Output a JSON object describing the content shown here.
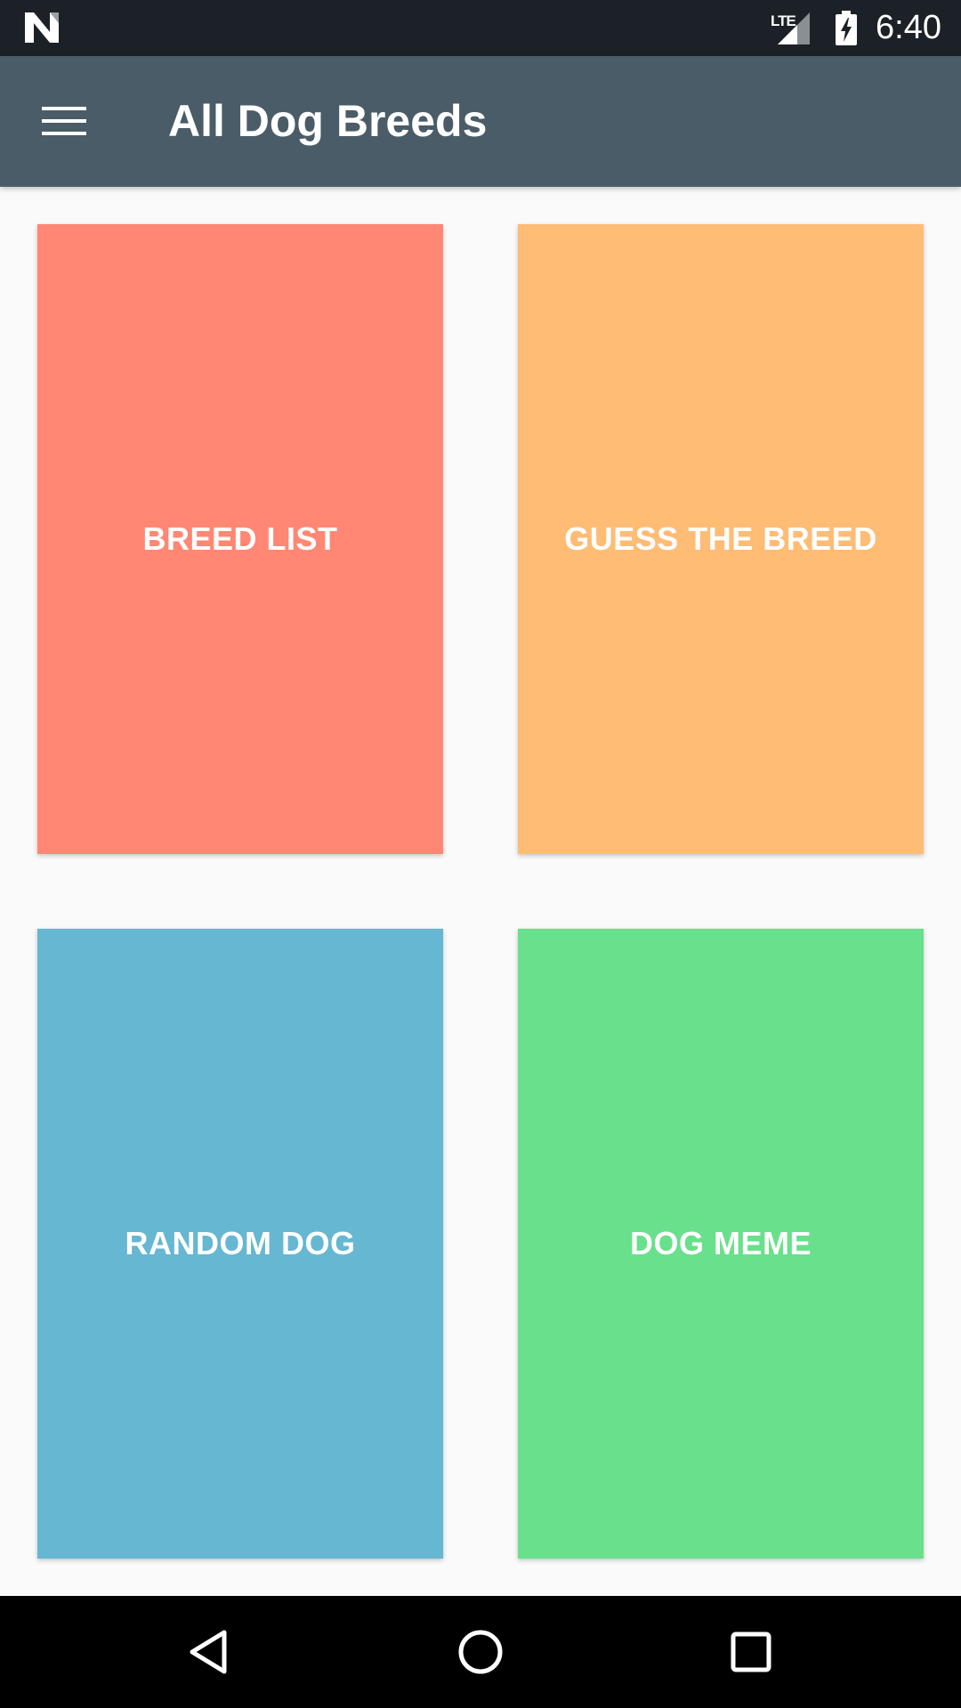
{
  "status_bar": {
    "network_label": "LTE",
    "time": "6:40",
    "icons": [
      "android-n-logo-icon",
      "signal-icon",
      "battery-charging-icon"
    ]
  },
  "app_bar": {
    "title": "All Dog Breeds",
    "menu_icon": "hamburger-menu-icon"
  },
  "tiles": [
    {
      "label": "BREED LIST",
      "color": "#ff8773"
    },
    {
      "label": "GUESS THE BREED",
      "color": "#ffbc75"
    },
    {
      "label": "RANDOM DOG",
      "color": "#66b7d2"
    },
    {
      "label": "DOG MEME",
      "color": "#69e08b"
    }
  ],
  "nav_bar": {
    "icons": [
      "back-icon",
      "home-icon",
      "recents-icon"
    ]
  },
  "colors": {
    "status_bar_bg": "#1b2126",
    "app_bar_bg": "#4a5c67",
    "content_bg": "#fafafa",
    "nav_bar_bg": "#000000"
  }
}
